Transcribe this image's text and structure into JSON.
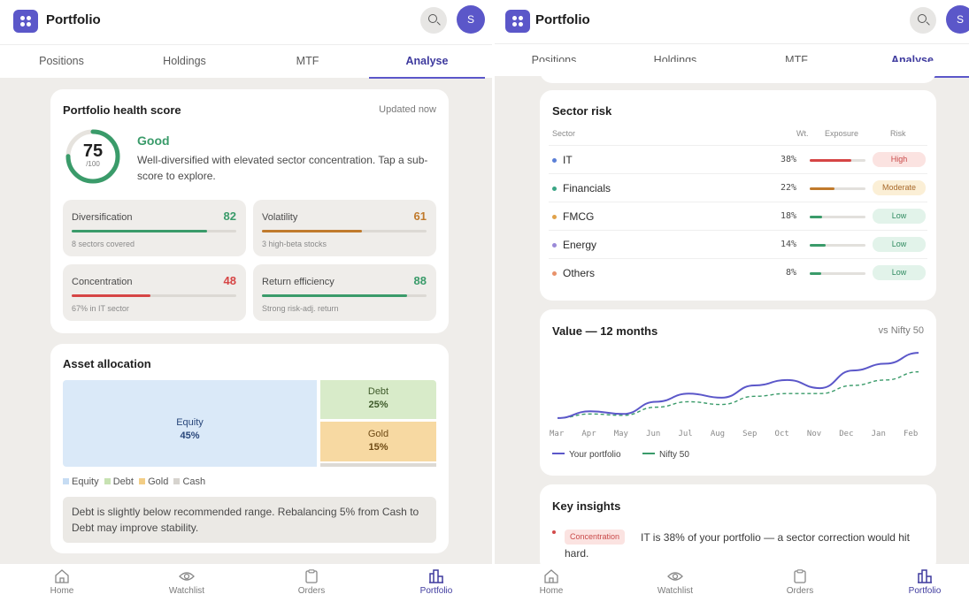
{
  "colors": {
    "accent": "#5b57c9",
    "good": "#3a9b6a",
    "warning": "#c07a2c",
    "danger": "#d64545"
  },
  "left": {
    "app_title": "Portfolio",
    "avatar_initial": "S",
    "tabs": [
      {
        "label": "Positions"
      },
      {
        "label": "Holdings"
      },
      {
        "label": "MTF"
      },
      {
        "label": "Analyse"
      }
    ],
    "active_tab": "Analyse",
    "health": {
      "title": "Portfolio health score",
      "updated": "Updated now",
      "score": "75",
      "score_max": "/100",
      "score_fraction": 0.75,
      "label": "Good",
      "description": "Well-diversified with elevated sector concentration. Tap a sub-score to explore.",
      "subscores": [
        {
          "name": "Diversification",
          "value": "82",
          "fraction": 0.82,
          "note": "8 sectors covered",
          "color": "#3a9b6a"
        },
        {
          "name": "Volatility",
          "value": "61",
          "fraction": 0.61,
          "note": "3 high-beta stocks",
          "color": "#c07a2c"
        },
        {
          "name": "Concentration",
          "value": "48",
          "fraction": 0.48,
          "note": "67% in IT sector",
          "color": "#d64545"
        },
        {
          "name": "Return efficiency",
          "value": "88",
          "fraction": 0.88,
          "note": "Strong risk-adj. return",
          "color": "#3a9b6a"
        }
      ]
    },
    "allocation": {
      "title": "Asset allocation",
      "tiles": [
        {
          "name": "Equity",
          "value": "45%"
        },
        {
          "name": "Debt",
          "value": "25%"
        },
        {
          "name": "Gold",
          "value": "15%"
        }
      ],
      "legend": [
        "Equity",
        "Debt",
        "Gold",
        "Cash"
      ],
      "note": "Debt is slightly below recommended range. Rebalancing 5% from Cash to Debt may improve stability."
    },
    "nav": [
      {
        "label": "Home"
      },
      {
        "label": "Watchlist"
      },
      {
        "label": "Orders"
      },
      {
        "label": "Portfolio"
      }
    ]
  },
  "right": {
    "app_title": "Portfolio",
    "avatar_initial": "S",
    "tabs": [
      {
        "label": "Positions"
      },
      {
        "label": "Holdings"
      },
      {
        "label": "MTF"
      },
      {
        "label": "Analyse"
      }
    ],
    "sector": {
      "title": "Sector risk",
      "headers": {
        "sector": "Sector",
        "wt": "Wt.",
        "exposure": "Exposure",
        "risk": "Risk"
      },
      "rows": [
        {
          "name": "IT",
          "wt": "38%",
          "exposure": 0.75,
          "risk": "High",
          "color": "#5b7fd6",
          "risk_color": "#c94a4a",
          "risk_bg": "#fbe3e1",
          "bar": "#d64545"
        },
        {
          "name": "Financials",
          "wt": "22%",
          "exposure": 0.45,
          "risk": "Moderate",
          "color": "#3aa584",
          "risk_color": "#a8692a",
          "risk_bg": "#fbefd6",
          "bar": "#c07a2c"
        },
        {
          "name": "FMCG",
          "wt": "18%",
          "exposure": 0.22,
          "risk": "Low",
          "color": "#e0a24a",
          "risk_color": "#2f8a60",
          "risk_bg": "#e2f3ea",
          "bar": "#3a9b6a"
        },
        {
          "name": "Energy",
          "wt": "14%",
          "exposure": 0.28,
          "risk": "Low",
          "color": "#9a8ad8",
          "risk_color": "#2f8a60",
          "risk_bg": "#e2f3ea",
          "bar": "#3a9b6a"
        },
        {
          "name": "Others",
          "wt": "8%",
          "exposure": 0.2,
          "risk": "Low",
          "color": "#e8926a",
          "risk_color": "#2f8a60",
          "risk_bg": "#e2f3ea",
          "bar": "#3a9b6a"
        }
      ]
    },
    "value_chart": {
      "title": "Value — 12 months",
      "compare": "vs Nifty 50",
      "legend": [
        "Your portfolio",
        "Nifty 50"
      ]
    },
    "insights": {
      "title": "Key insights",
      "tag": "Concentration",
      "text": "IT is 38% of your portfolio — a sector correction would hit hard."
    },
    "nav": [
      {
        "label": "Home"
      },
      {
        "label": "Watchlist"
      },
      {
        "label": "Orders"
      },
      {
        "label": "Portfolio"
      }
    ]
  },
  "chart_data": {
    "type": "line",
    "x": [
      "Mar",
      "Apr",
      "May",
      "Jun",
      "Jul",
      "Aug",
      "Sep",
      "Oct",
      "Nov",
      "Dec",
      "Jan",
      "Feb"
    ],
    "series": [
      {
        "name": "Your portfolio",
        "values": [
          100,
          105,
          103,
          112,
          118,
          115,
          124,
          128,
          122,
          135,
          140,
          148
        ],
        "color": "#5b57c9"
      },
      {
        "name": "Nifty 50",
        "values": [
          100,
          103,
          102,
          108,
          112,
          110,
          116,
          118,
          118,
          124,
          128,
          134
        ],
        "color": "#3a9b6a"
      }
    ],
    "grid": false,
    "legend_position": "bottom-left"
  }
}
